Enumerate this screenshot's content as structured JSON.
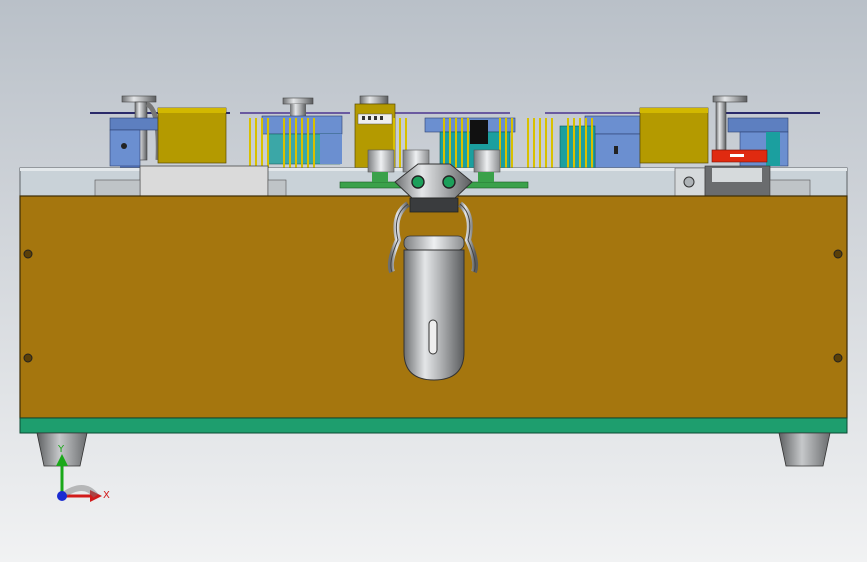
{
  "view": {
    "background_top": "#b9c0c8",
    "background_bottom": "#f1f2f3"
  },
  "colors": {
    "enclosure_panel": "#a5760e",
    "base_strip": "#1e9e6e",
    "top_plate": "#c9d2d8",
    "gold_block": "#b49a00",
    "blue_part": "#6b8fd0",
    "teal_part": "#1b9f9f",
    "pin": "#d8c000",
    "pcb": "#3aa14a",
    "red_part": "#e02a10",
    "latch_metal": "#a9abad"
  },
  "triad": {
    "x_label": "X",
    "y_label": "Y",
    "x_color": "#d11a1a",
    "y_color": "#1aa81a",
    "z_color": "#1a2bd1"
  },
  "icons": {
    "triad": "coordinate-triad-icon",
    "latch": "toggle-latch-icon",
    "screw": "screw-head-icon"
  }
}
